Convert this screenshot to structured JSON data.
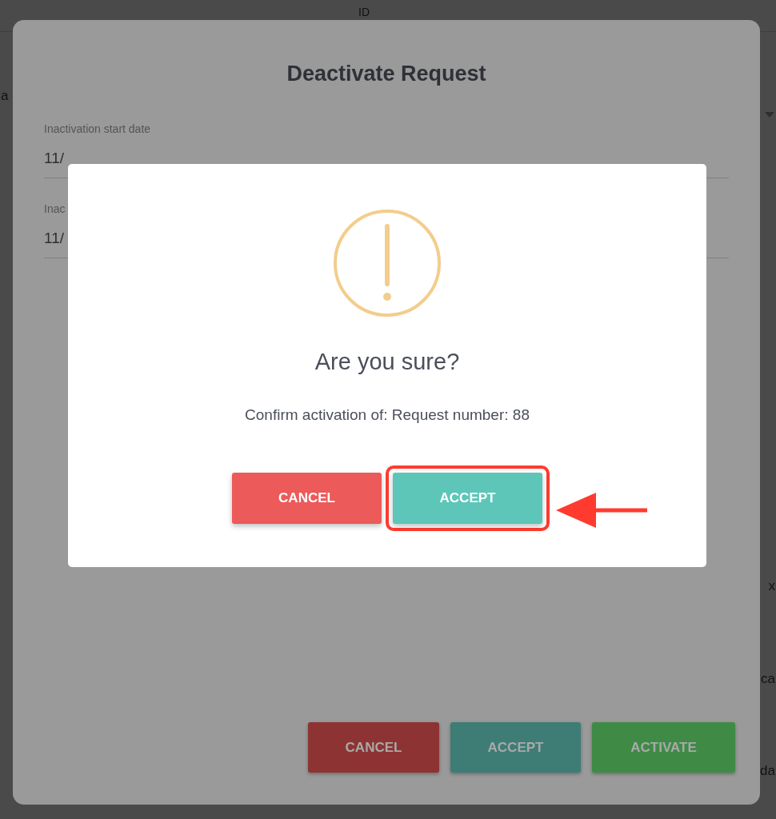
{
  "background_page": {
    "column_header": "ID",
    "fragment_left": "a",
    "fragments_right": [
      "x",
      "ca",
      "da"
    ]
  },
  "deactivate_dialog": {
    "title": "Deactivate Request",
    "fields": [
      {
        "label": "Inactivation start date",
        "value": "11/"
      },
      {
        "label": "Inac",
        "value": "11/"
      }
    ],
    "buttons": [
      {
        "kind": "cancel",
        "label": "CANCEL"
      },
      {
        "kind": "accept",
        "label": "ACCEPT"
      },
      {
        "kind": "activate",
        "label": "ACTIVATE"
      }
    ]
  },
  "confirm_dialog": {
    "title": "Are you sure?",
    "message": "Confirm activation of: Request number: 88",
    "buttons": [
      {
        "kind": "cancel",
        "label": "CANCEL",
        "highlighted": false
      },
      {
        "kind": "accept",
        "label": "ACCEPT",
        "highlighted": true
      }
    ]
  }
}
